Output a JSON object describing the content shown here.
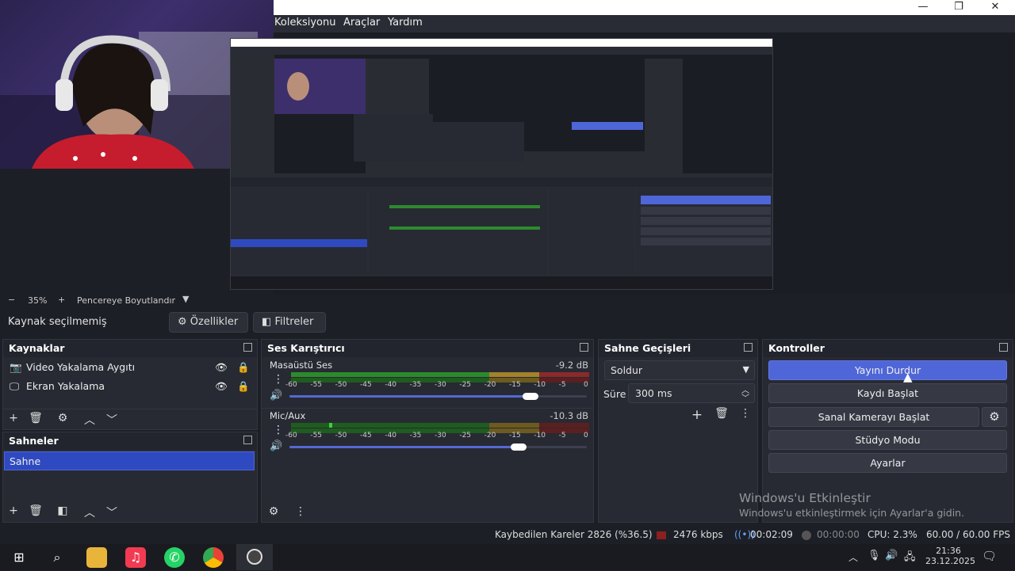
{
  "window": {
    "minimize": "—",
    "maximize": "❐",
    "close": "✕"
  },
  "menu": {
    "items": [
      "Koleksiyonu",
      "Araçlar",
      "Yardım"
    ]
  },
  "zoom": {
    "minus": "−",
    "value": "35%",
    "plus": "+",
    "mode": "Pencereye Boyutlandır"
  },
  "toolbar": {
    "no_source": "Kaynak seçilmemiş",
    "properties": "Özellikler",
    "filters": "Filtreler"
  },
  "sources": {
    "title": "Kaynaklar",
    "items": [
      {
        "label": "Video Yakalama Aygıtı",
        "icon": "camera-icon"
      },
      {
        "label": "Ekran Yakalama",
        "icon": "monitor-icon"
      }
    ]
  },
  "scenes": {
    "title": "Sahneler",
    "items": [
      "Sahne"
    ]
  },
  "mixer": {
    "title": "Ses Karıştırıcı",
    "channels": [
      {
        "name": "Masaüstü Ses",
        "db": "-9.2 dB",
        "volume": 0.81
      },
      {
        "name": "Mic/Aux",
        "db": "-10.3 dB",
        "volume": 0.77
      }
    ],
    "scale": [
      "-60",
      "-55",
      "-50",
      "-45",
      "-40",
      "-35",
      "-30",
      "-25",
      "-20",
      "-15",
      "-10",
      "-5",
      "0"
    ]
  },
  "transitions": {
    "title": "Sahne Geçişleri",
    "selected": "Soldur",
    "duration_label": "Süre",
    "duration": "300 ms"
  },
  "controls": {
    "title": "Kontroller",
    "stop_stream": "Yayını Durdur",
    "start_record": "Kaydı Başlat",
    "virtual_cam": "Sanal Kamerayı Başlat",
    "studio_mode": "Stüdyo Modu",
    "settings": "Ayarlar"
  },
  "status": {
    "dropped": "Kaybedilen Kareler 2826 (%36.5)",
    "bitrate": "2476 kbps",
    "stream_time": "00:02:09",
    "record_time": "00:00:00",
    "cpu": "CPU: 2.3%",
    "fps": "60.00 / 60.00 FPS"
  },
  "watermark": {
    "title": "Windows'u Etkinleştir",
    "subtitle": "Windows'u etkinleştirmek için Ayarlar'a gidin."
  },
  "clock": {
    "time": "21:36",
    "date": "23.12.2025"
  },
  "colors": {
    "accent": "#4f66d8",
    "panel": "#272a33",
    "bg": "#1d1f26"
  }
}
